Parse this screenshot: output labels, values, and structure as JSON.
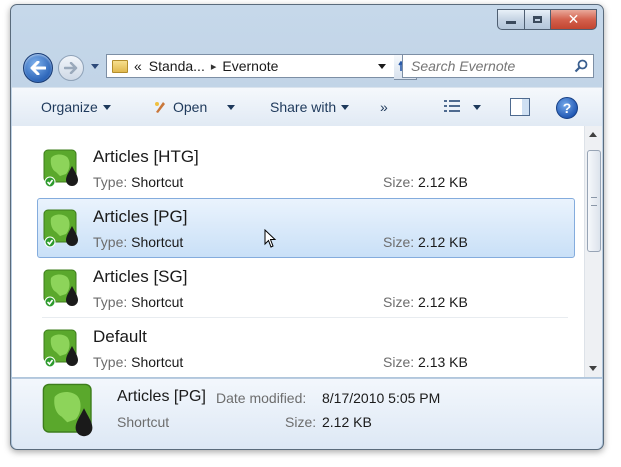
{
  "window": {
    "caption_buttons": {
      "minimize_icon": "minimize-icon",
      "maximize_icon": "maximize-icon",
      "close_glyph": "✕"
    }
  },
  "nav": {
    "back_icon": "back-arrow-icon",
    "forward_icon": "forward-arrow-icon",
    "breadcrumb": {
      "overflow": "«",
      "parent": "Standa...",
      "separator": "▸",
      "current": "Evernote"
    },
    "refresh_icon": "refresh-icon",
    "search_placeholder": "Search Evernote"
  },
  "toolbar": {
    "organize": "Organize",
    "open": "Open",
    "share_with": "Share with",
    "more": "»",
    "help": "?"
  },
  "files": [
    {
      "name": "Articles [HTG]",
      "type_label": "Type:",
      "type": "Shortcut",
      "size_label": "Size:",
      "size": "2.12 KB",
      "selected": false
    },
    {
      "name": "Articles [PG]",
      "type_label": "Type:",
      "type": "Shortcut",
      "size_label": "Size:",
      "size": "2.12 KB",
      "selected": true
    },
    {
      "name": "Articles [SG]",
      "type_label": "Type:",
      "type": "Shortcut",
      "size_label": "Size:",
      "size": "2.12 KB",
      "selected": false
    },
    {
      "name": "Default",
      "type_label": "Type:",
      "type": "Shortcut",
      "size_label": "Size:",
      "size": "2.13 KB",
      "selected": false
    }
  ],
  "details": {
    "name": "Articles [PG]",
    "date_modified_label": "Date modified:",
    "date_modified": "8/17/2010 5:05 PM",
    "type": "Shortcut",
    "size_label": "Size:",
    "size": "2.12 KB"
  },
  "colors": {
    "selection_bg": "#c9e0f7",
    "evernote_green": "#5aa82c",
    "accent_blue": "#1e395b"
  }
}
